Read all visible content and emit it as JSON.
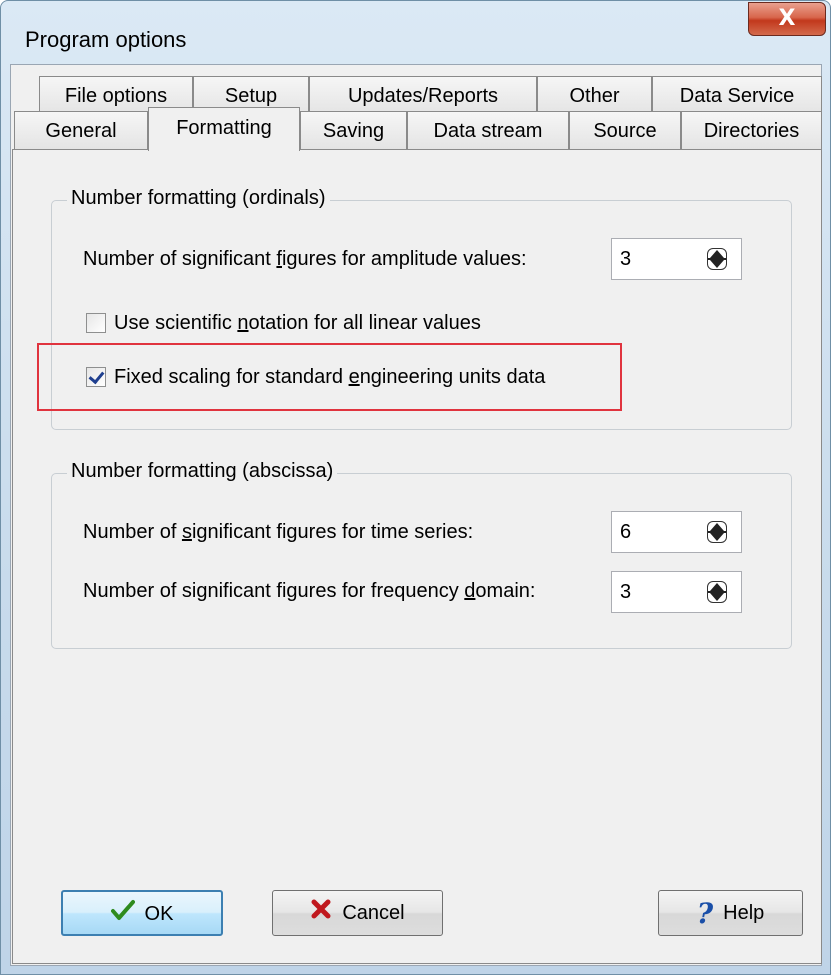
{
  "window": {
    "title": "Program options",
    "close_label": "X"
  },
  "tabs": {
    "row1": [
      "File options",
      "Setup",
      "Updates/Reports",
      "Other",
      "Data Service"
    ],
    "row2": [
      "General",
      "Formatting",
      "Saving",
      "Data stream",
      "Source",
      "Directories"
    ],
    "active": "Formatting"
  },
  "ordinals": {
    "title": "Number formatting (ordinals)",
    "amp_pre": "Number of significant ",
    "amp_key": "f",
    "amp_post": "igures for amplitude values:",
    "amp_value": "3",
    "sci_pre": "Use scientific ",
    "sci_key": "n",
    "sci_post": "otation for all linear values",
    "sci_checked": false,
    "fixed_pre": "Fixed scaling for standard ",
    "fixed_key": "e",
    "fixed_post": "ngineering units data",
    "fixed_checked": true
  },
  "abscissa": {
    "title": "Number formatting (abscissa)",
    "time_pre": "Number of ",
    "time_key": "s",
    "time_post": "ignificant figures for time series:",
    "time_value": "6",
    "freq_pre": "Number of significant figures for frequency ",
    "freq_key": "d",
    "freq_post": "omain:",
    "freq_value": "3"
  },
  "buttons": {
    "ok": "OK",
    "cancel": "Cancel",
    "help": "Help"
  },
  "colors": {
    "highlight": "#e0333e",
    "ok_check": "#2e8b1e",
    "cancel_x": "#c0181e",
    "help_q": "#1a4fa8"
  }
}
